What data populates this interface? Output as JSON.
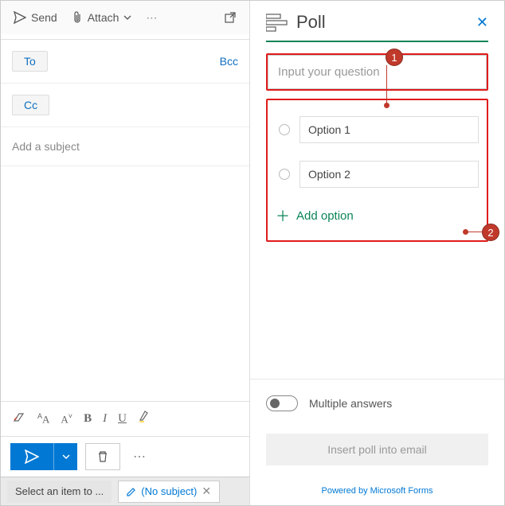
{
  "compose": {
    "toolbar": {
      "send": "Send",
      "attach": "Attach"
    },
    "recipients": {
      "to": "To",
      "cc": "Cc",
      "bcc": "Bcc"
    },
    "subject_placeholder": "Add a subject",
    "tabs": {
      "select": "Select an item to ...",
      "nosubject": "(No subject)"
    }
  },
  "poll": {
    "title": "Poll",
    "question_placeholder": "Input your question",
    "options": [
      "Option 1",
      "Option 2"
    ],
    "add_option": "Add option",
    "multiple": "Multiple answers",
    "insert": "Insert poll into email",
    "powered": "Powered by Microsoft Forms"
  },
  "annotations": {
    "badge1": "1",
    "badge2": "2"
  }
}
